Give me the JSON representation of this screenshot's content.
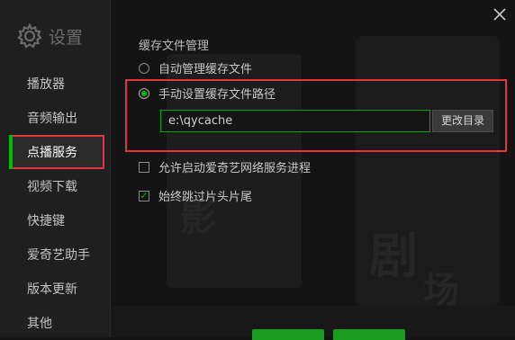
{
  "window": {
    "title": "设置"
  },
  "sidebar": {
    "items": [
      {
        "label": "播放器"
      },
      {
        "label": "音频输出"
      },
      {
        "label": "点播服务"
      },
      {
        "label": "视频下载"
      },
      {
        "label": "快捷键"
      },
      {
        "label": "爱奇艺助手"
      },
      {
        "label": "版本更新"
      },
      {
        "label": "其他"
      }
    ],
    "active_index": 2
  },
  "cache": {
    "section_title": "缓存文件管理",
    "auto_option": "自动管理缓存文件",
    "manual_option": "手动设置缓存文件路径",
    "path_value": "e:\\qycache",
    "change_button": "更改目录",
    "allow_service": "允许启动爱奇艺网络服务进程",
    "skip_intro": "始终跳过片头片尾",
    "selected_option": "manual",
    "allow_service_checked": false,
    "skip_intro_checked": true
  },
  "colors": {
    "accent_green": "#00be06",
    "highlight_red": "#e0353d",
    "background": "#141414"
  },
  "icons": {
    "settings": "gear-icon",
    "close": "close-icon"
  }
}
